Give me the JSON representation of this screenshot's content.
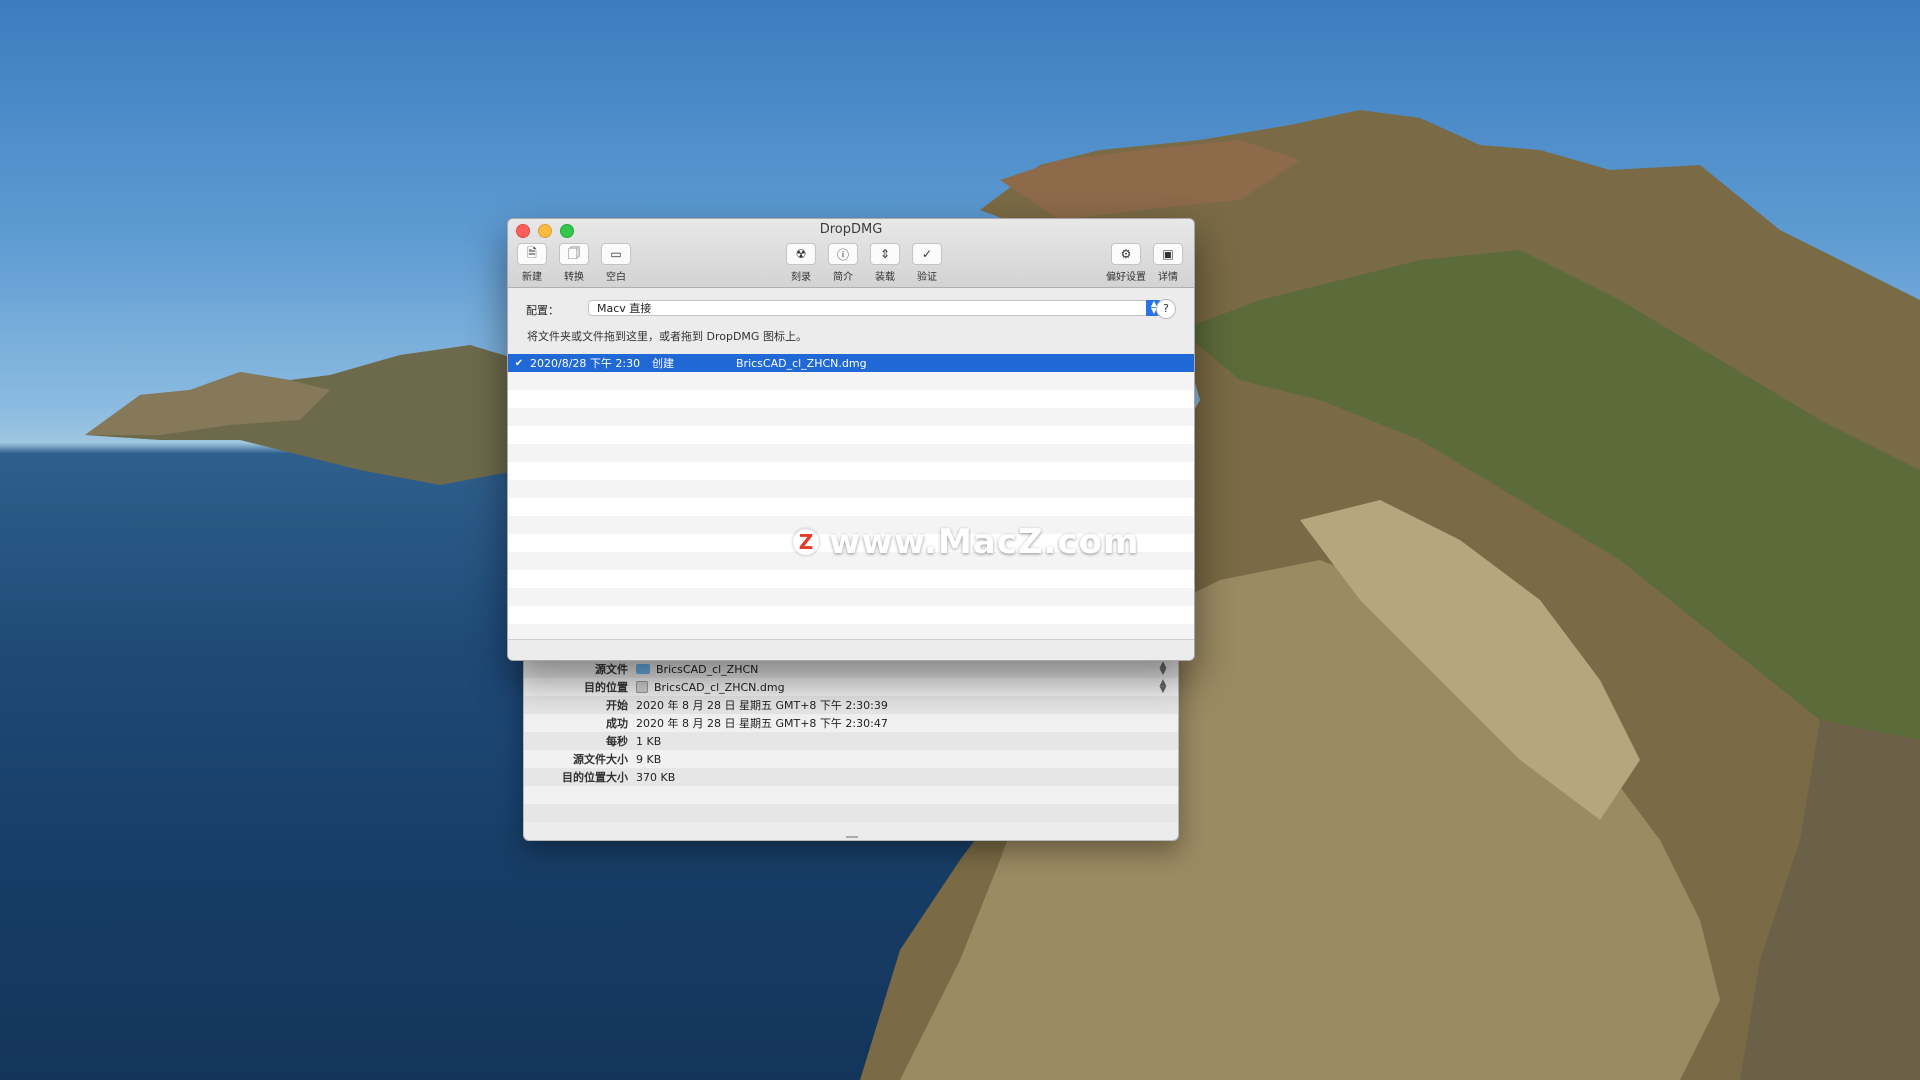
{
  "window": {
    "title": "DropDMG"
  },
  "toolbar": {
    "left": [
      {
        "label": "新建",
        "icon": "new-doc-icon"
      },
      {
        "label": "转换",
        "icon": "convert-doc-icon"
      },
      {
        "label": "空白",
        "icon": "blank-disk-icon"
      }
    ],
    "center": [
      {
        "label": "刻录",
        "icon": "burn-icon"
      },
      {
        "label": "简介",
        "icon": "info-icon"
      },
      {
        "label": "装载",
        "icon": "mount-icon"
      },
      {
        "label": "验证",
        "icon": "verify-icon"
      }
    ],
    "right": [
      {
        "label": "偏好设置",
        "icon": "gear-icon"
      },
      {
        "label": "详情",
        "icon": "details-icon"
      }
    ]
  },
  "config": {
    "label": "配置：",
    "selected": "Macv 直接"
  },
  "help_label": "?",
  "hint": "将文件夹或文件拖到这里，或者拖到 DropDMG 图标上。",
  "log": [
    {
      "date": "2020/8/28 下午 2:30",
      "action": "创建",
      "file": "BricsCAD_cl_ZHCN.dmg"
    }
  ],
  "details": [
    {
      "label": "源文件",
      "value": "BricsCAD_cl_ZHCN"
    },
    {
      "label": "目的位置",
      "value": "BricsCAD_cl_ZHCN.dmg"
    },
    {
      "label": "开始",
      "value": "2020 年 8 月 28 日 星期五 GMT+8 下午 2:30:39"
    },
    {
      "label": "成功",
      "value": "2020 年 8 月 28 日 星期五 GMT+8 下午 2:30:47"
    },
    {
      "label": "每秒",
      "value": "1 KB"
    },
    {
      "label": "源文件大小",
      "value": "9 KB"
    },
    {
      "label": "目的位置大小",
      "value": "370 KB"
    }
  ],
  "watermark": {
    "badge": "Z",
    "text": "www.MacZ.com"
  }
}
